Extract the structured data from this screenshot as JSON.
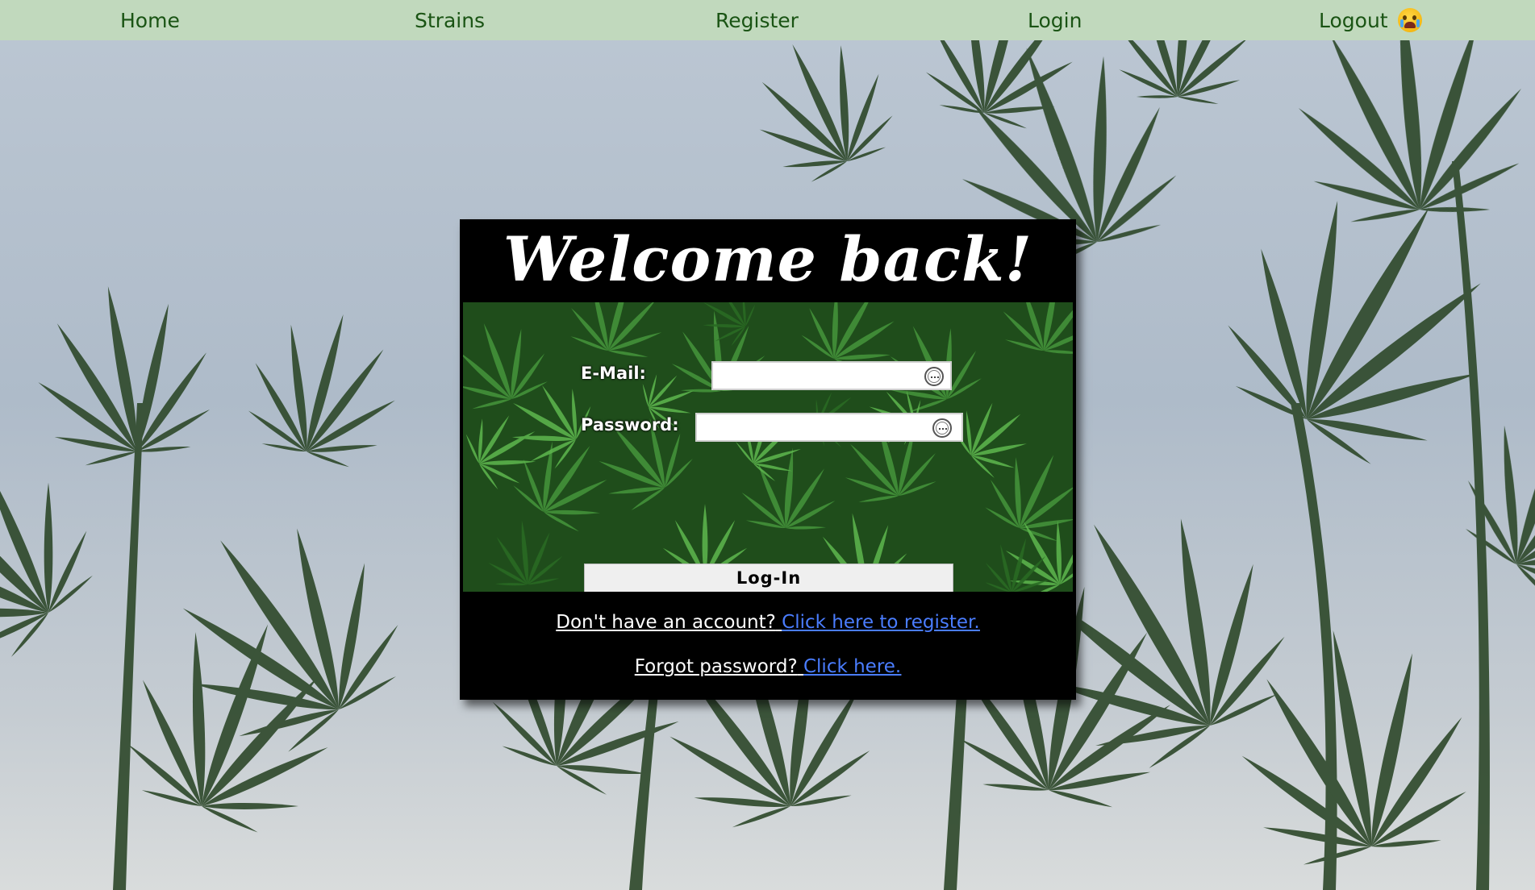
{
  "nav": {
    "home": "Home",
    "strains": "Strains",
    "register": "Register",
    "login": "Login",
    "logout": "Logout"
  },
  "login_card": {
    "title": "Welcome back!",
    "email_label": "E-Mail:",
    "email_value": "",
    "password_label": "Password:",
    "password_value": "",
    "submit_label": "Log-In",
    "register_prompt": "Don't have an account?",
    "register_link": "Click here to register.",
    "forgot_prompt": "Forgot password?",
    "forgot_link": "Click here."
  },
  "icons": {
    "logout": "crying-face-icon",
    "input_autofill": "password-manager-icon"
  },
  "colors": {
    "nav_background": "#c1d9bd",
    "nav_text": "#1a5414",
    "card_background": "#000000",
    "link": "#4a7dff"
  }
}
